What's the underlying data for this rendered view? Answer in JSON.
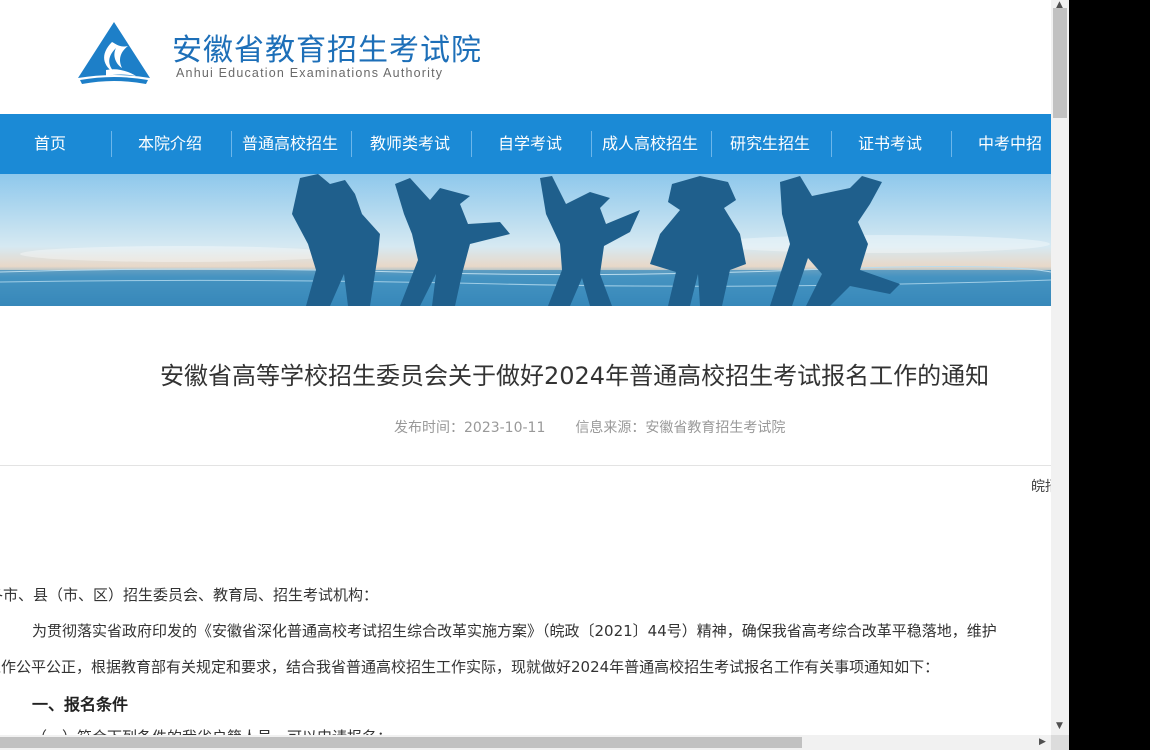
{
  "header": {
    "brand_cn": "安徽省教育招生考试院",
    "brand_en": "Anhui Education Examinations Authority",
    "logo_icon": "triangle-flame-logo-icon"
  },
  "nav": {
    "items": [
      "首页",
      "本院介绍",
      "普通高校招生",
      "教师类考试",
      "自学考试",
      "成人高校招生",
      "研究生招生",
      "证书考试",
      "中考中招"
    ]
  },
  "article": {
    "title": "安徽省高等学校招生委员会关于做好2024年普通高校招生考试报名工作的通知",
    "publish_time": "发布时间：2023-10-11",
    "source": "信息来源：安徽省教育招生考试院",
    "doc_no": "皖招",
    "salutation": "各市、县（市、区）招生委员会、教育局、招生考试机构：",
    "para1_line1": "为贯彻落实省政府印发的《安徽省深化普通高校考试招生综合改革实施方案》（皖政〔2021〕44号）精神，确保我省高考综合改革平稳落地，维护",
    "para1_line2": "工作公平公正，根据教育部有关规定和要求，结合我省普通高校招生工作实际，现就做好2024年普通高校招生考试报名工作有关事项通知如下：",
    "section1": "一、报名条件",
    "sub1": "（一）符合下列条件的我省户籍人员，可以申请报名："
  },
  "colors": {
    "brand_blue": "#1d6fb8",
    "nav_blue": "#1b8ad6",
    "silhouette": "#1f5f8c"
  }
}
